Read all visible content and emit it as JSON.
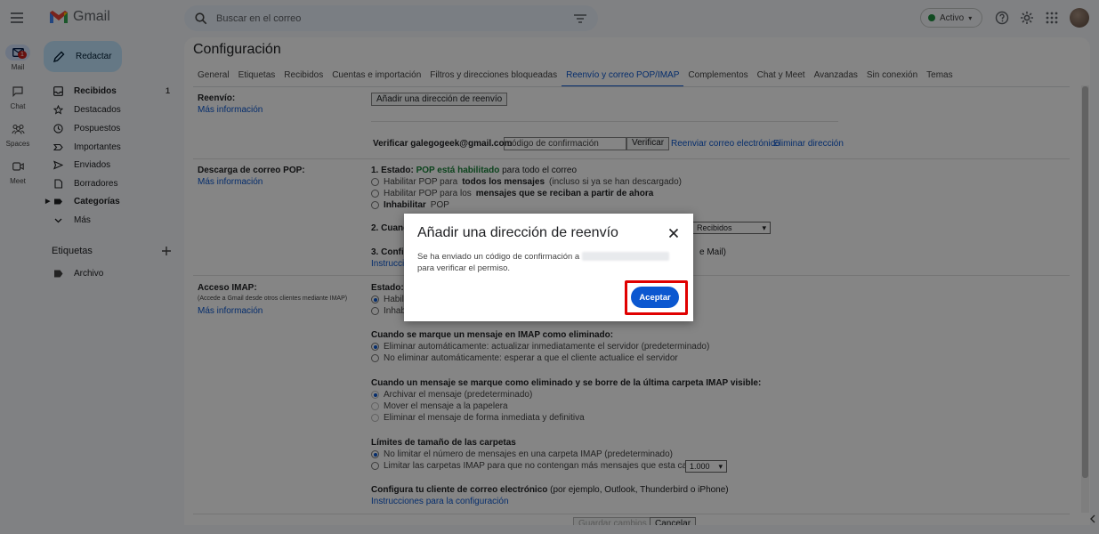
{
  "app": {
    "name": "Gmail"
  },
  "search": {
    "placeholder": "Buscar en el correo"
  },
  "status": {
    "label": "Activo",
    "color": "#1e8e3e"
  },
  "rail": {
    "mail": {
      "label": "Mail",
      "badge": "1"
    },
    "chat": {
      "label": "Chat"
    },
    "spaces": {
      "label": "Spaces"
    },
    "meet": {
      "label": "Meet"
    }
  },
  "compose": {
    "label": "Redactar"
  },
  "nav": [
    {
      "label": "Recibidos",
      "count": "1",
      "icon": "inbox-icon",
      "bold": true
    },
    {
      "label": "Destacados",
      "icon": "star-icon"
    },
    {
      "label": "Pospuestos",
      "icon": "clock-icon"
    },
    {
      "label": "Importantes",
      "icon": "label-important-icon"
    },
    {
      "label": "Enviados",
      "icon": "send-icon"
    },
    {
      "label": "Borradores",
      "icon": "draft-icon"
    },
    {
      "label": "Categorías",
      "icon": "category-icon",
      "bold": true
    },
    {
      "label": "Más",
      "icon": "chevron-down-icon"
    }
  ],
  "labels": {
    "heading": "Etiquetas",
    "items": [
      {
        "label": "Archivo"
      }
    ]
  },
  "settings": {
    "title": "Configuración",
    "tabs": [
      "General",
      "Etiquetas",
      "Recibidos",
      "Cuentas e importación",
      "Filtros y direcciones bloqueadas",
      "Reenvío y correo POP/IMAP",
      "Complementos",
      "Chat y Meet",
      "Avanzadas",
      "Sin conexión",
      "Temas"
    ],
    "active_tab": "Reenvío y correo POP/IMAP",
    "more_info": "Más información",
    "forwarding": {
      "label": "Reenvío:",
      "add_button": "Añadir una dirección de reenvío",
      "verify_prefix": "Verificar galegogeek@gmail.com",
      "code_placeholder": "código de confirmación",
      "verify_button": "Verificar",
      "resend_link": "Reenviar correo electrónico",
      "delete_link": "Eliminar dirección"
    },
    "pop": {
      "label": "Descarga de correo POP:",
      "status_prefix": "1. Estado:",
      "status_value": "POP está habilitado",
      "status_suffix": "para todo el correo",
      "opt1_a": "Habilitar POP para",
      "opt1_b": "todos los mensajes",
      "opt1_c": "(incluso si ya se han descargado)",
      "opt2_a": "Habilitar POP para los",
      "opt2_b": "mensajes que se reciban a partir de ahora",
      "opt3_a": "Inhabilitar",
      "opt3_b": "POP",
      "q2_prefix": "2. Cuand",
      "q2_select": "Recibidos",
      "q3_prefix": "3. Config",
      "q3_suffix": "e Mail)",
      "q3_link": "Instruccio"
    },
    "imap": {
      "label": "Acceso IMAP:",
      "note": "(Accede a Gmail desde otros clientes mediante IMAP)",
      "status_prefix": "Estado:",
      "opt_enable": "Habili",
      "opt_disable": "Inhab",
      "deleted_heading": "Cuando se marque un mensaje en IMAP como eliminado:",
      "deleted_opt1": "Eliminar automáticamente: actualizar inmediatamente el servidor (predeterminado)",
      "deleted_opt2": "No eliminar automáticamente: esperar a que el cliente actualice el servidor",
      "expunge_heading": "Cuando un mensaje se marque como eliminado y se borre de la última carpeta IMAP visible:",
      "expunge_opt1": "Archivar el mensaje (predeterminado)",
      "expunge_opt2": "Mover el mensaje a la papelera",
      "expunge_opt3": "Eliminar el mensaje de forma inmediata y definitiva",
      "limits_heading": "Límites de tamaño de las carpetas",
      "limits_opt1": "No limitar el número de mensajes en una carpeta IMAP (predeterminado)",
      "limits_opt2": "Limitar las carpetas IMAP para que no contengan más mensajes que esta cantidad",
      "limits_select": "1.000",
      "client_heading": "Configura tu cliente de correo electrónico",
      "client_suffix": "(por ejemplo, Outlook, Thunderbird o iPhone)",
      "client_link": "Instrucciones para la configuración"
    },
    "save_button": "Guardar cambios",
    "cancel_button": "Cancelar"
  },
  "dialog": {
    "title": "Añadir una dirección de reenvío",
    "message_prefix": "Se ha enviado un código de confirmación a",
    "message_suffix": "para verificar el permiso.",
    "ok_button": "Aceptar"
  },
  "colors": {
    "accent": "#0b57d0",
    "highlight": "#e00000",
    "compose_bg": "#c2e7ff"
  }
}
